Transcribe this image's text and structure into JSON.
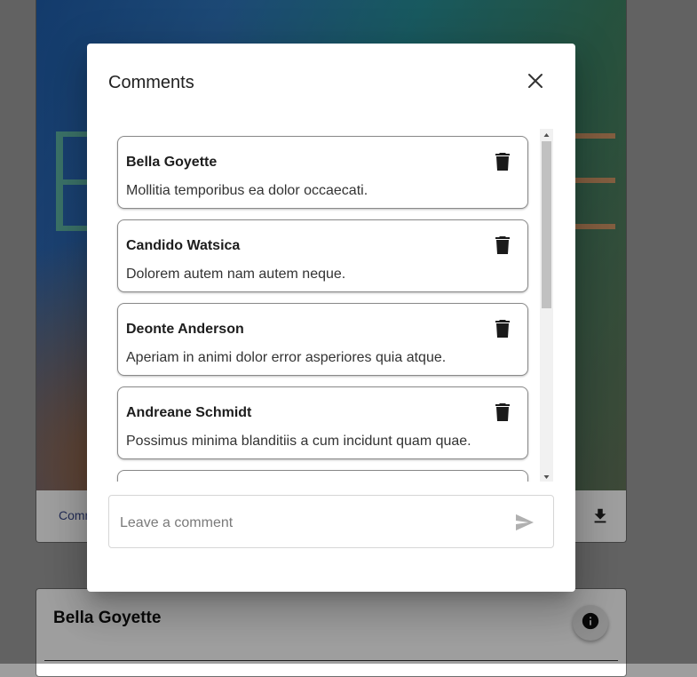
{
  "background": {
    "comment_link_label": "Comments",
    "card_author": "Bella Goyette",
    "download_icon": "download-icon",
    "info_icon": "info-icon"
  },
  "dialog": {
    "title": "Comments",
    "close_icon": "close-icon",
    "comments": [
      {
        "author": "Bella Goyette",
        "text": "Mollitia temporibus ea dolor occaecati."
      },
      {
        "author": "Candido Watsica",
        "text": "Dolorem autem nam autem neque."
      },
      {
        "author": "Deonte Anderson",
        "text": "Aperiam in animi dolor error asperiores quia atque."
      },
      {
        "author": "Andreane Schmidt",
        "text": "Possimus minima blanditiis a cum incidunt quam quae."
      },
      {
        "author": "",
        "text": ""
      }
    ],
    "delete_icon": "delete-icon",
    "input": {
      "placeholder": "Leave a comment",
      "value": ""
    },
    "send_icon": "send-icon"
  },
  "colors": {
    "scrim": "#000000",
    "dialog_bg": "#ffffff",
    "card_border": "#8a8a8a"
  }
}
